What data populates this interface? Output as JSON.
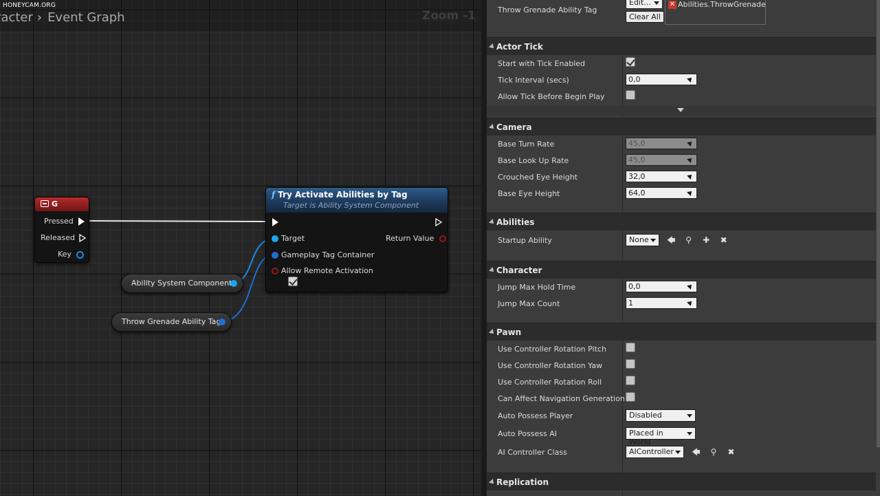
{
  "watermark": "HONEYCAM.ORG",
  "graph": {
    "breadcrumb_parent": "racter",
    "breadcrumb_sep": "›",
    "breadcrumb_current": "Event Graph",
    "zoom": "Zoom -1",
    "key_node": {
      "title": "G",
      "pins": {
        "pressed": "Pressed",
        "released": "Released",
        "key": "Key"
      }
    },
    "function_node": {
      "fn_glyph": "f",
      "title": "Try Activate Abilities by Tag",
      "subtitle": "Target is Ability System Component",
      "pins": {
        "target": "Target",
        "tag_container": "Gameplay Tag Container",
        "allow_remote": "Allow Remote Activation",
        "return_value": "Return Value"
      },
      "allow_remote_checked": true
    },
    "var_nodes": {
      "asc": "Ability System Component",
      "tag": "Throw Grenade Ability Tag"
    },
    "colors": {
      "exec": "#ffffff",
      "object_pin": "#1aa7f0",
      "struct_pin": "#1f6fd1",
      "bool_pin": "#8e1a1a",
      "wire_blue": "#1a8ce8"
    }
  },
  "details": {
    "top_row": {
      "label": "Throw Grenade Ability Tag",
      "edit_combo": "Edit...",
      "clear_btn": "Clear All",
      "tag_value": "Abilities.ThrowGrenade"
    },
    "actor_tick": {
      "title": "Actor Tick",
      "start_with_tick": "Start with Tick Enabled",
      "tick_interval": "Tick Interval (secs)",
      "tick_interval_val": "0,0",
      "allow_tick": "Allow Tick Before Begin Play"
    },
    "camera": {
      "title": "Camera",
      "rows": [
        {
          "label": "Base Turn Rate",
          "value": "45,0"
        },
        {
          "label": "Base Look Up Rate",
          "value": "45,0"
        },
        {
          "label": "Crouched Eye Height",
          "value": "32,0"
        },
        {
          "label": "Base Eye Height",
          "value": "64,0"
        }
      ]
    },
    "abilities": {
      "title": "Abilities",
      "startup_label": "Startup Ability",
      "startup_val": "None"
    },
    "character": {
      "title": "Character",
      "rows": [
        {
          "label": "Jump Max Hold Time",
          "value": "0,0"
        },
        {
          "label": "Jump Max Count",
          "value": "1"
        }
      ]
    },
    "pawn": {
      "title": "Pawn",
      "pitch": "Use Controller Rotation Pitch",
      "yaw": "Use Controller Rotation Yaw",
      "roll": "Use Controller Rotation Roll",
      "nav": "Can Affect Navigation Generation",
      "auto_player": "Auto Possess Player",
      "auto_player_val": "Disabled",
      "auto_ai": "Auto Possess AI",
      "auto_ai_val": "Placed in World",
      "ai_class": "AI Controller Class",
      "ai_class_val": "AIController"
    },
    "replication": {
      "title": "Replication"
    }
  }
}
